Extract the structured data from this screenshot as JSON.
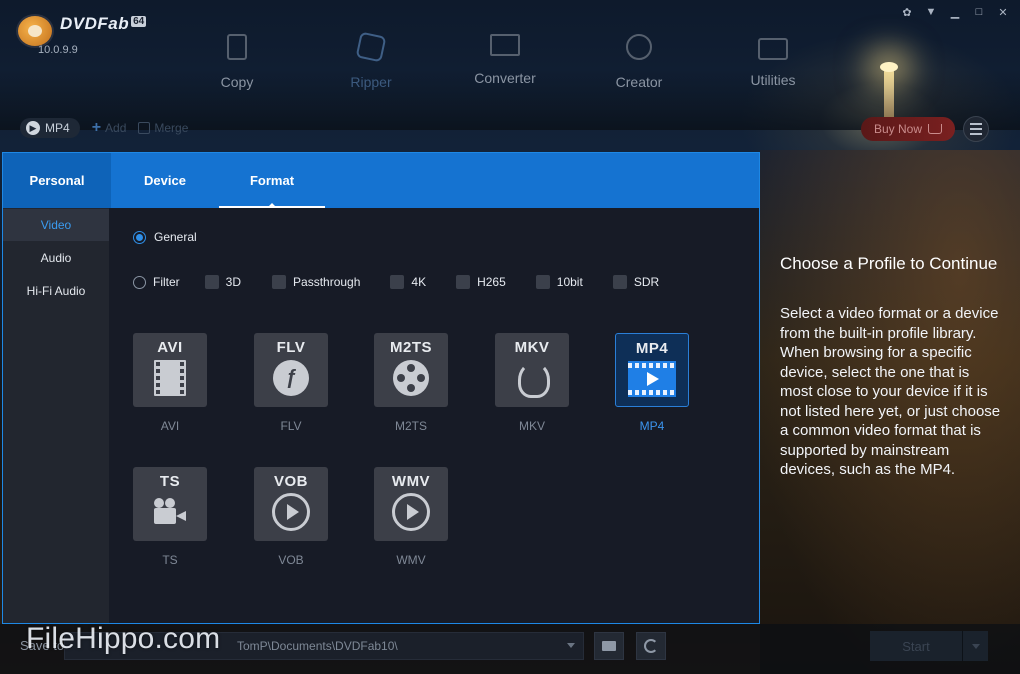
{
  "app": {
    "name": "DVDFab",
    "arch_badge": "64",
    "version": "10.0.9.9"
  },
  "window_controls": [
    "gift-icon",
    "minimize-to-tray-icon",
    "minimize-icon",
    "maximize-icon",
    "close-icon"
  ],
  "main_nav": [
    {
      "label": "Copy",
      "icon": "copy-icon",
      "active": false
    },
    {
      "label": "Ripper",
      "icon": "ripper-icon",
      "active": true
    },
    {
      "label": "Converter",
      "icon": "converter-icon",
      "active": false
    },
    {
      "label": "Creator",
      "icon": "creator-icon",
      "active": false
    },
    {
      "label": "Utilities",
      "icon": "utilities-icon",
      "active": false
    }
  ],
  "toolbar": {
    "profile_label": "MP4",
    "add_label": "Add",
    "merge_label": "Merge",
    "buy_now_label": "Buy Now"
  },
  "panel": {
    "tabs": [
      {
        "label": "Personal"
      },
      {
        "label": "Device"
      },
      {
        "label": "Format",
        "active": true
      }
    ],
    "side_items": [
      {
        "label": "Video",
        "active": true
      },
      {
        "label": "Audio"
      },
      {
        "label": "Hi-Fi Audio"
      }
    ],
    "general_label": "General",
    "filter_label": "Filter",
    "filters": [
      "3D",
      "Passthrough",
      "4K",
      "H265",
      "10bit",
      "SDR"
    ],
    "formats": [
      {
        "code": "AVI",
        "label": "AVI",
        "icon": "film-icon"
      },
      {
        "code": "FLV",
        "label": "FLV",
        "icon": "flash-icon"
      },
      {
        "code": "M2TS",
        "label": "M2TS",
        "icon": "film-reel-icon"
      },
      {
        "code": "MKV",
        "label": "MKV",
        "icon": "matroska-icon"
      },
      {
        "code": "MP4",
        "label": "MP4",
        "icon": "mp4-play-icon",
        "selected": true
      },
      {
        "code": "TS",
        "label": "TS",
        "icon": "video-camera-icon"
      },
      {
        "code": "VOB",
        "label": "VOB",
        "icon": "play-circle-icon"
      },
      {
        "code": "WMV",
        "label": "WMV",
        "icon": "play-circle-icon"
      }
    ]
  },
  "info": {
    "title": "Choose a Profile to Continue",
    "body": "Select a video format or a device from the built-in profile library. When browsing for a specific device, select the one that is most close to your device if it is not listed here yet, or just choose a common video format that is supported by mainstream devices, such as the MP4."
  },
  "bottom": {
    "save_label": "Save to:",
    "path_value": "TomP\\Documents\\DVDFab10\\",
    "start_label": "Start"
  },
  "watermark": "FileHippo.com"
}
